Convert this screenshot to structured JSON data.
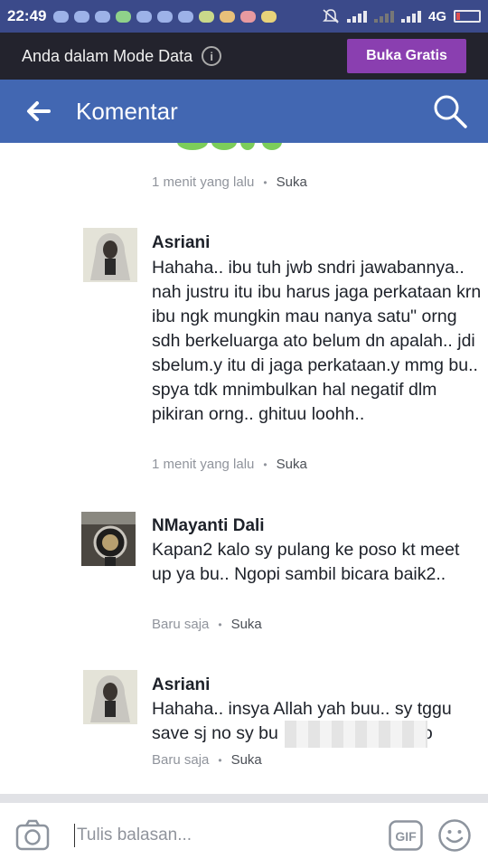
{
  "status_bar": {
    "time": "22:49",
    "network": "4G",
    "notification_icons": [
      "chat-icon",
      "mail-icon",
      "mail-icon",
      "whatsapp-icon",
      "mail-icon",
      "mail-icon",
      "mail-icon",
      "app-icon",
      "app-icon",
      "chat-icon",
      "chat-icon"
    ]
  },
  "data_mode": {
    "text": "Anda dalam Mode Data",
    "button": "Buka Gratis"
  },
  "app_bar": {
    "title": "Komentar"
  },
  "comments": [
    {
      "time": "1 menit yang lalu",
      "action": "Suka"
    },
    {
      "author": "Asriani",
      "text": "Hahaha.. ibu tuh jwb sndri jawabannya.. nah justru itu ibu harus jaga perkataan krn ibu ngk mungkin mau nanya satu\" orng sdh berkeluarga ato belum dn apalah.. jdi sbelum.y itu di jaga perkataan.y mmg bu.. spya tdk mnimbulkan hal negatif dlm pikiran orng.. ghituu loohh..",
      "time": "1 menit yang lalu",
      "action": "Suka"
    },
    {
      "author": "NMayanti Dali",
      "text": "Kapan2 kalo sy pulang ke poso kt meet up ya bu.. Ngopi sambil bicara baik2..",
      "time": "Baru saja",
      "action": "Suka"
    },
    {
      "author": "Asriani",
      "text_line1": "Hahaha.. insya Allah yah buu.. sy tggu",
      "text_line2_start": "save sj no sy bu",
      "text_line2_end": "o",
      "time": "Baru saja",
      "action": "Suka"
    }
  ],
  "composer": {
    "placeholder": "Tulis balasan..."
  },
  "colors": {
    "brand": "#4267b2",
    "data_button": "#8a3fb0",
    "data_bar": "#23232d",
    "status_bar": "#3b4a8a"
  }
}
